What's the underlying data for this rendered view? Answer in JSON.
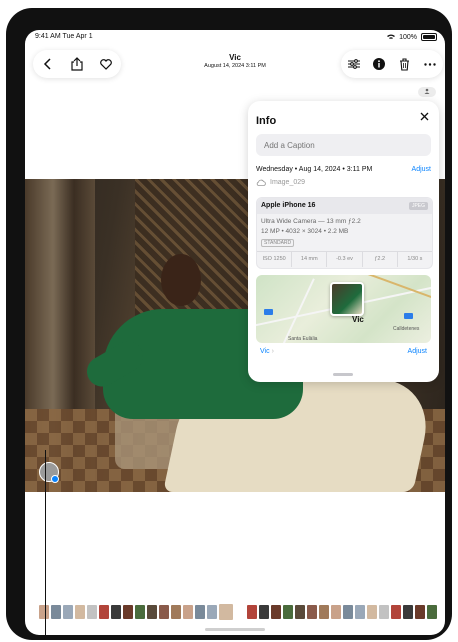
{
  "status": {
    "time": "9:41 AM  Tue Apr 1",
    "battery": "100%"
  },
  "header": {
    "title": "Vic",
    "subtitle": "August 14, 2024  3:11 PM"
  },
  "info": {
    "title": "Info",
    "caption_placeholder": "Add a Caption",
    "datetime": "Wednesday • Aug 14, 2024 • 3:11 PM",
    "adjust_label": "Adjust",
    "filename": "Image_029",
    "camera": {
      "name": "Apple iPhone 16",
      "format": "JPEG",
      "lens": "Ultra Wide Camera — 13 mm ƒ2.2",
      "specs": "12 MP • 4032 × 3024 • 2.2 MB",
      "style": "STANDARD",
      "exif": [
        "ISO 1250",
        "14 mm",
        "-0.3 ev",
        "ƒ2.2",
        "1/30 s"
      ]
    },
    "map": {
      "place": "Vic",
      "town": "Calldetenes",
      "bottom": "Santa Eulàlia"
    },
    "location_link": "Vic",
    "location_adjust": "Adjust"
  },
  "icons": {
    "back": "chevron-left-icon",
    "share": "share-icon",
    "favorite": "heart-icon",
    "adjust": "sliders-icon",
    "info": "info-icon",
    "delete": "trash-icon",
    "more": "ellipsis-icon"
  },
  "colors": {
    "accent": "#0a84ff"
  }
}
